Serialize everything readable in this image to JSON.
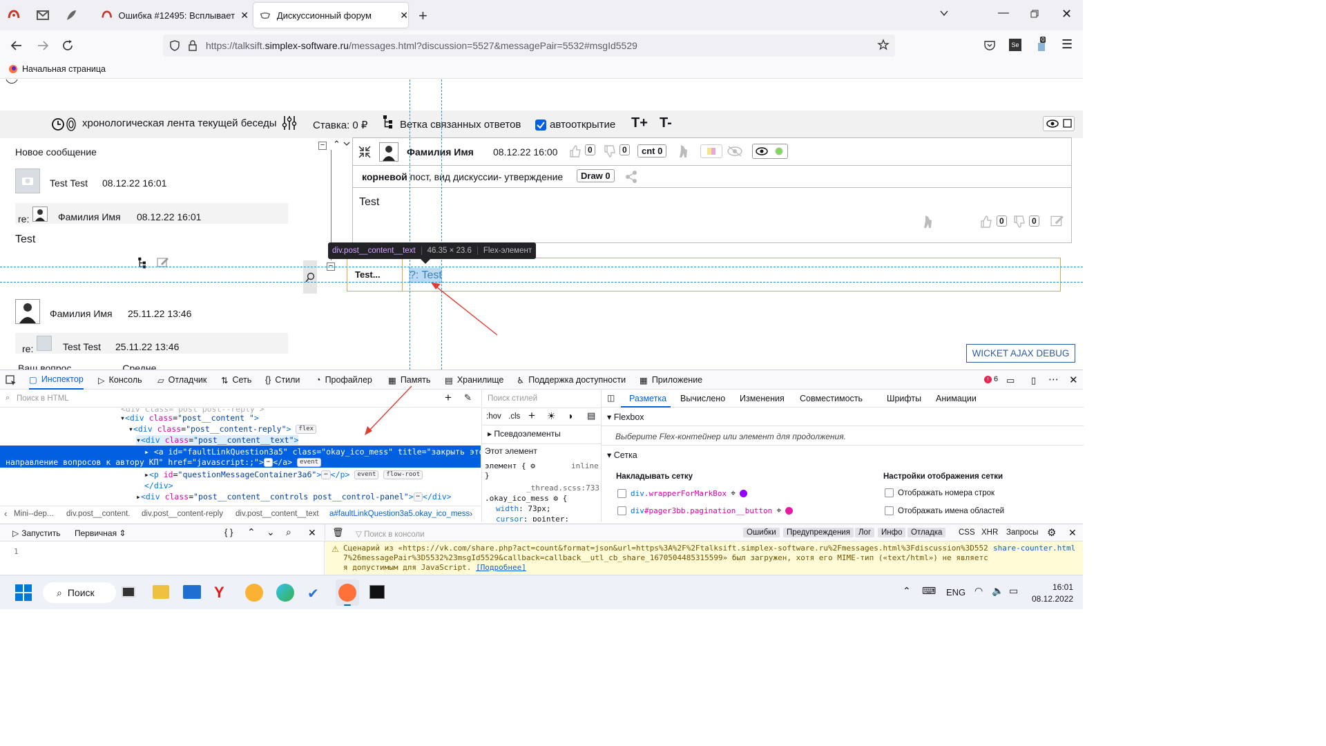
{
  "browser": {
    "tabs": [
      {
        "title": "Ошибка #12495: Всплывает ок"
      },
      {
        "title": "Дискуссионный форум"
      }
    ],
    "url_prefix": "https://talksift.",
    "url_host": "simplex-software.ru",
    "url_rest": "/messages.html?discussion=5527&messagePair=5532#msgId5529",
    "bookmark": "Начальная страница",
    "ext_badge": "0"
  },
  "toolbar": {
    "timeline": "хронологическая лента текущей беседы",
    "stake": "Ставка: 0 ₽",
    "branch": "Ветка связанных ответов",
    "autoopen": "автооткрытие",
    "tplus": "T+",
    "tminus": "T-"
  },
  "left": {
    "new_message": "Новое сообщение",
    "m1_name": "Test Test",
    "m1_date": "08.12.22 16:01",
    "re": "re:",
    "m1_re_name": "Фамилия Имя",
    "m1_re_date": "08.12.22 16:01",
    "m1_text": "Test",
    "m2_name": "Фамилия Имя",
    "m2_date": "25.11.22 13:46",
    "m2_re_name": "Test Test",
    "m2_re_date": "25.11.22 13:46",
    "cut_text": "Ваш вопрос...                Средне..."
  },
  "post": {
    "author": "Фамилия Имя",
    "date": "08.12.22 16:00",
    "likes": "0",
    "dislikes": "0",
    "cnt": "cnt 0",
    "root_bold": "корневой",
    "root_rest": " пост, вид дискуссии- утверждение",
    "draw": "Draw 0",
    "body": "Test",
    "foot_likes": "0",
    "foot_dislikes": "0",
    "reply_label": "Test...",
    "reply_link": "?: Test"
  },
  "tooltip": {
    "selector": "div.post__content__text",
    "size": "46.35 × 23.6",
    "kind": "Flex-элемент"
  },
  "wicket": "WICKET AJAX DEBUG",
  "devtools": {
    "tabs": [
      "Инспектор",
      "Консоль",
      "Отладчик",
      "Сеть",
      "Стили",
      "Профайлер",
      "Память",
      "Хранилище",
      "Поддержка доступности",
      "Приложение"
    ],
    "error_count": "6",
    "html_search": "Поиск в HTML",
    "styles_search": "Поиск стилей",
    "hov": ":hov",
    "cls": ".cls",
    "pseudo": "Псевдоэлементы",
    "this_el": "Этот элемент",
    "element_rule": "элемент {",
    "inline": "inline",
    "close_brace": "}",
    "thread_file": "_thread.scss:733",
    "okay_rule": ".okay_ico_mess",
    "width_prop": "width",
    "width_val": "73px;",
    "cursor_prop": "cursor",
    "cursor_val": "pointer;",
    "right_tabs": [
      "Разметка",
      "Вычислено",
      "Изменения",
      "Совместимость",
      "Шрифты",
      "Анимации"
    ],
    "flexbox": "Flexbox",
    "flex_hint": "Выберите Flex-контейнер или элемент для продолжения.",
    "grid": "Сетка",
    "overlay_grid": "Накладывать сетку",
    "grid_settings": "Настройки отображения сетки",
    "grid1_tag": "div",
    "grid1_sel": ".wrapperForMarkBox",
    "grid2_tag": "div",
    "grid2_sel": "#pager3bb.pagination__button",
    "show_line_numbers": "Отображать номера строк",
    "show_area_names": "Отображать имена областей",
    "breadcrumbs": [
      "Mini--dep...",
      "div.post__content.",
      "div.post__content-reply",
      "div.post__content__text",
      "a#faultLinkQuestion3a5.okay_ico_mess"
    ],
    "run": "Запустить",
    "primary": "Первичная",
    "console_search": "Поиск в консоли",
    "filters": [
      "Ошибки",
      "Предупреждения",
      "Лог",
      "Инфо",
      "Отладка",
      "CSS",
      "XHR",
      "Запросы"
    ],
    "line_no": "1",
    "warning_text": "Сценарий из «https://vk.com/share.php?act=count&format=json&url=https%3A%2F%2Ftalksift.simplex-software.ru%2Fmessages.html%3Fdiscussion%3D5527%26messagePair%3D5532%23msgId5529&callback=callback__utl_cb_share_1670504485315599» был загружен, хотя его MIME-тип («text/html») не является допустимым для JavaScript.",
    "warning_link": "[Подробнее]",
    "warning_source": "share-counter.html"
  },
  "html_tree": {
    "l1_tag_open": "<div ",
    "l1_attr": "class",
    "l1_val": "\"post__content \"",
    "l2_attr": "class",
    "l2_val": "\"post__content-reply\"",
    "l2_badge": "flex",
    "l3_attr": "class",
    "l3_val": "\"post__content__text\"",
    "sel_line1": "<a id=\"faultLinkQuestion3a5\" class=\"okay_ico_mess\" title=\"закрыть это",
    "sel_line2": "направление вопросов к автору КП\" href=\"javascript:;\">",
    "sel_end": "</a>",
    "sel_badge": "event",
    "l5_attr": "id",
    "l5_val": "\"questionMessageContainer3a6\"",
    "l5_badge1": "event",
    "l5_badge2": "flow-root",
    "l6": "</div>",
    "l7_attr": "class",
    "l7_val": "\"post__content__controls post__control-panel\""
  },
  "taskbar": {
    "search": "Поиск",
    "lang": "ENG",
    "time": "16:01",
    "date": "08.12.2022"
  }
}
